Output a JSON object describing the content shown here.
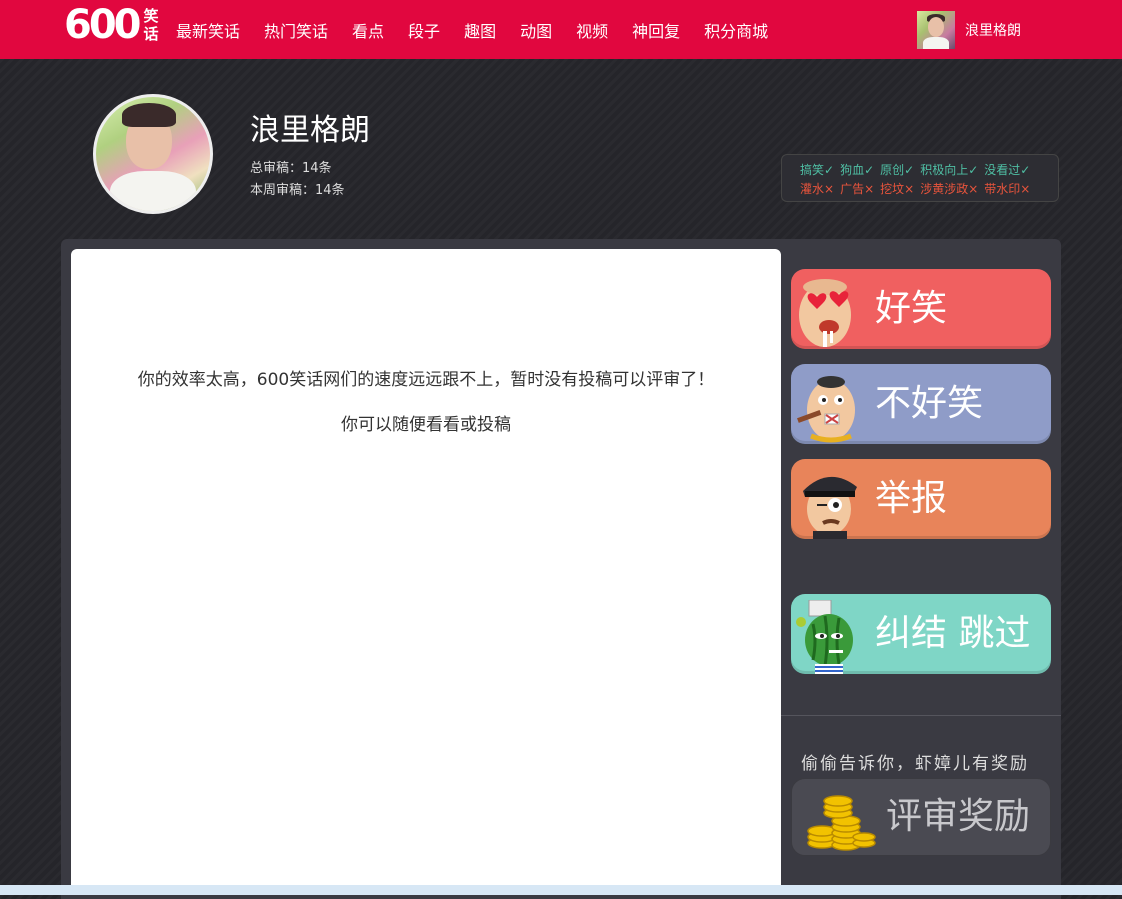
{
  "logo": {
    "number": "600",
    "char1": "笑",
    "char2": "话"
  },
  "nav": [
    {
      "label": "最新笑话"
    },
    {
      "label": "热门笑话"
    },
    {
      "label": "看点"
    },
    {
      "label": "段子"
    },
    {
      "label": "趣图"
    },
    {
      "label": "动图"
    },
    {
      "label": "视频"
    },
    {
      "label": "神回复"
    },
    {
      "label": "积分商城"
    }
  ],
  "user": {
    "name": "浪里格朗",
    "total_review": "总审稿：14条",
    "week_review": "本周审稿：14条"
  },
  "rules": {
    "ok": [
      "搞笑✓",
      "狗血✓",
      "原创✓",
      "积极向上✓",
      "没看过✓"
    ],
    "no": [
      "灌水×",
      "广告×",
      "挖坟×",
      "涉黄涉政×",
      "带水印×"
    ]
  },
  "content": {
    "message": "你的效率太高，600笑话网们的速度远远跟不上，暂时没有投稿可以评审了！",
    "hint_prefix": "你可以",
    "hint_link1": "随便看看",
    "hint_mid": "或",
    "hint_link2": "投稿"
  },
  "votes": {
    "funny": "好笑",
    "not_funny": "不好笑",
    "report": "举报",
    "skip": "纠结 跳过"
  },
  "reward": {
    "tip": "偷偷告诉你，虾嫜儿有奖励",
    "label": "评审奖励"
  },
  "colors": {
    "brand": "#e1073f",
    "funny": "#f06060",
    "not_funny": "#8f9cc8",
    "report": "#e8845a",
    "skip": "#7fd6c6",
    "rule_ok": "#4fbfa4",
    "rule_no": "#e8543c"
  }
}
